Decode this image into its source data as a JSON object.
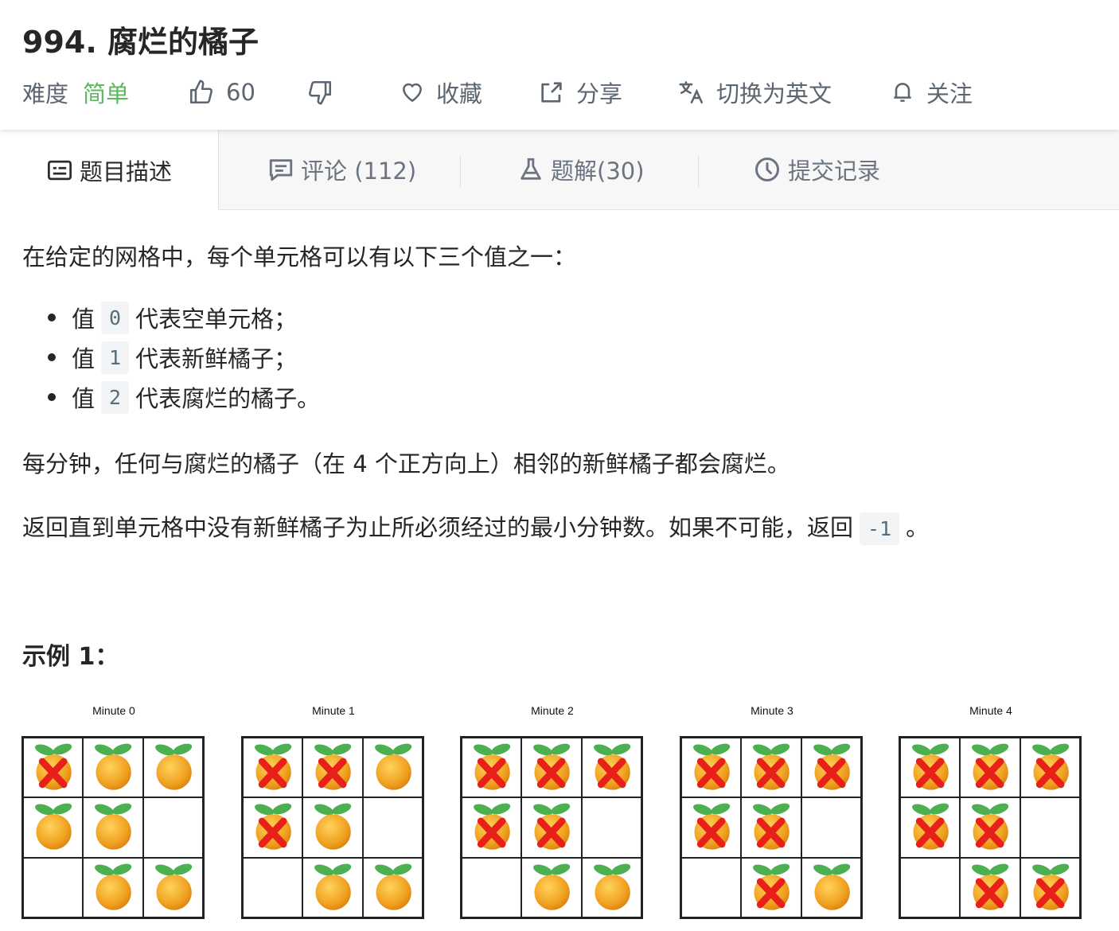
{
  "problem": {
    "title": "994. 腐烂的橘子",
    "difficulty_label": "难度",
    "difficulty_value": "简单",
    "likes": "60",
    "favorite_label": "收藏",
    "share_label": "分享",
    "switch_lang_label": "切换为英文",
    "follow_label": "关注"
  },
  "tabs": [
    {
      "label": "题目描述",
      "icon": "description-icon"
    },
    {
      "label": "评论 (112)",
      "icon": "comment-icon"
    },
    {
      "label": "题解(30)",
      "icon": "flask-icon"
    },
    {
      "label": "提交记录",
      "icon": "clock-icon"
    }
  ],
  "description": {
    "intro": "在给定的网格中，每个单元格可以有以下三个值之一：",
    "items": [
      {
        "pre": "值",
        "code": "0",
        "post": "代表空单元格；"
      },
      {
        "pre": "值",
        "code": "1",
        "post": "代表新鲜橘子；"
      },
      {
        "pre": "值",
        "code": "2",
        "post": "代表腐烂的橘子。"
      }
    ],
    "rule": "每分钟，任何与腐烂的橘子（在 4 个正方向上）相邻的新鲜橘子都会腐烂。",
    "ask_pre": "返回直到单元格中没有新鲜橘子为止所必须经过的最小分钟数。如果不可能，返回",
    "ask_code": "-1",
    "ask_post": "。"
  },
  "example": {
    "title": "示例 1：",
    "minutes": [
      {
        "label": "Minute 0",
        "grid": [
          [
            2,
            1,
            1
          ],
          [
            1,
            1,
            0
          ],
          [
            0,
            1,
            1
          ]
        ]
      },
      {
        "label": "Minute 1",
        "grid": [
          [
            2,
            2,
            1
          ],
          [
            2,
            1,
            0
          ],
          [
            0,
            1,
            1
          ]
        ]
      },
      {
        "label": "Minute 2",
        "grid": [
          [
            2,
            2,
            2
          ],
          [
            2,
            2,
            0
          ],
          [
            0,
            1,
            1
          ]
        ]
      },
      {
        "label": "Minute 3",
        "grid": [
          [
            2,
            2,
            2
          ],
          [
            2,
            2,
            0
          ],
          [
            0,
            2,
            1
          ]
        ]
      },
      {
        "label": "Minute 4",
        "grid": [
          [
            2,
            2,
            2
          ],
          [
            2,
            2,
            0
          ],
          [
            0,
            2,
            2
          ]
        ]
      }
    ]
  },
  "colors": {
    "accent_green": "#5cb85c",
    "orange": "#f0a020",
    "rot_x": "#e8201a",
    "leaf": "#4caf50"
  }
}
